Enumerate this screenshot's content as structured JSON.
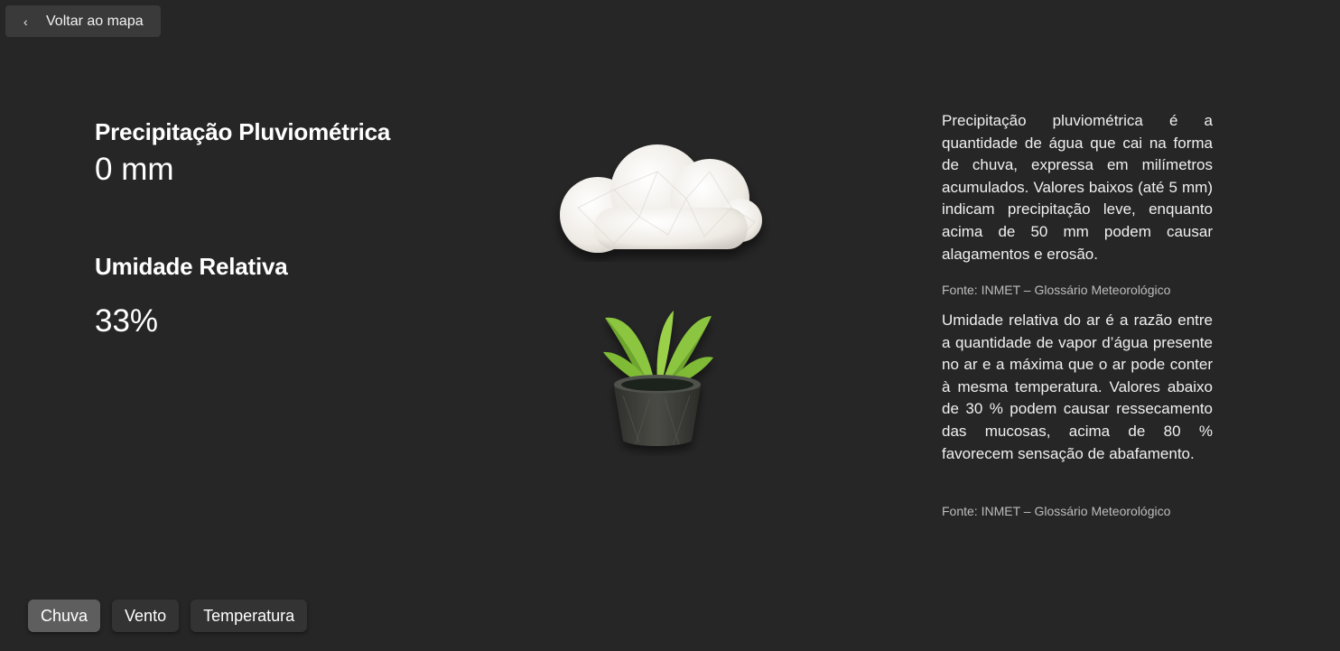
{
  "back_button": {
    "label": "Voltar ao mapa",
    "icon": "chevron-left-icon"
  },
  "metrics": {
    "precipitation": {
      "title": "Precipitação Pluviométrica",
      "value": "0 mm"
    },
    "humidity": {
      "title": "Umidade Relativa",
      "value": "33%"
    }
  },
  "illustrations": {
    "top": "cloud-icon",
    "bottom": "potted-plant-icon"
  },
  "descriptions": {
    "precipitation": {
      "text": "Precipitação pluviométrica é a quantidade de água que cai na forma de chuva, expressa em milímetros acumulados. Valores baixos (até 5 mm) indicam precipitação leve, enquanto acima de 50 mm podem causar alagamentos e erosão.",
      "source": "Fonte: INMET – Glossário Meteorológico"
    },
    "humidity": {
      "text": "Umidade relativa do ar é a razão entre a quantidade de vapor d’água presente no ar e a máxima que o ar pode conter à mesma temperatura. Valores abaixo de 30 % podem causar ressecamento das mucosas, acima de 80 % favorecem sensação de abafamento.",
      "source": "Fonte: INMET – Glossário Meteorológico"
    }
  },
  "tabs": [
    {
      "label": "Chuva",
      "active": true
    },
    {
      "label": "Vento",
      "active": false
    },
    {
      "label": "Temperatura",
      "active": false
    }
  ],
  "colors": {
    "background": "#262626",
    "tab_active": "#5e5e5e",
    "tab_inactive": "#333333",
    "leaf": "#8cc63f",
    "pot": "#3e3f3a"
  }
}
